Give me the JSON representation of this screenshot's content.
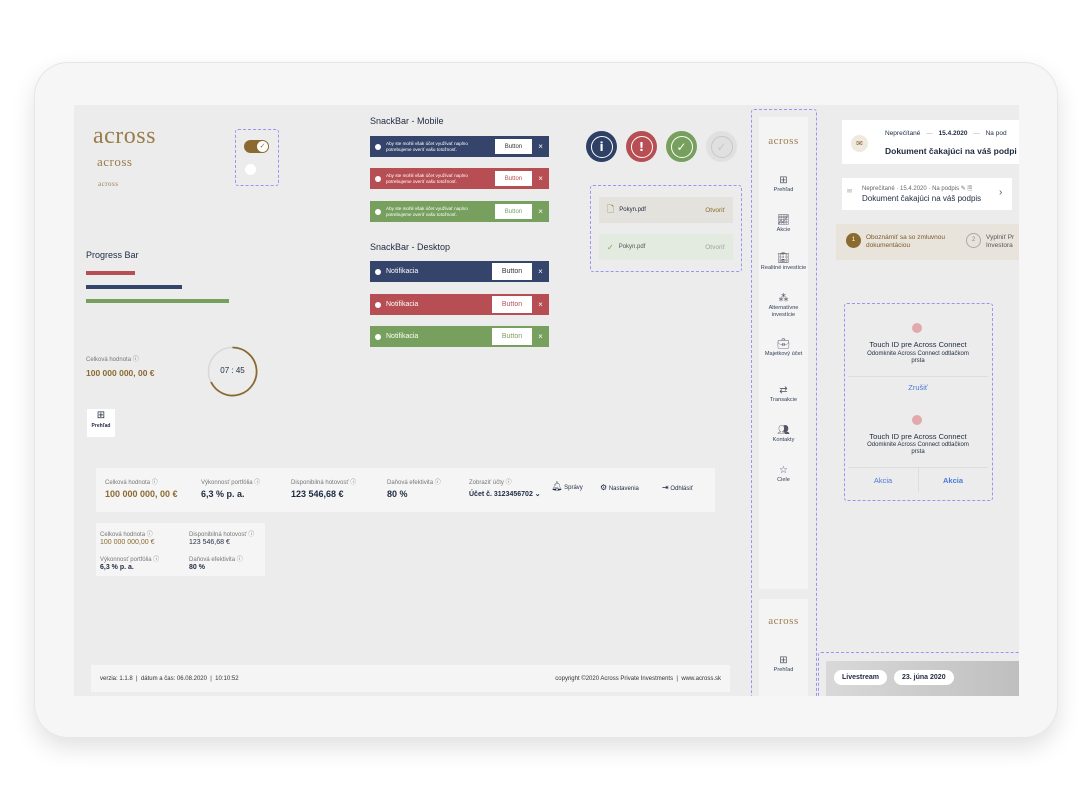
{
  "logo": {
    "text": "across"
  },
  "snackbar_mobile": {
    "title": "SnackBar - Mobile",
    "message": "Aby ste mohli však účet využívať naplno potrebujeme overiť vašu totožnosť.",
    "button": "Button",
    "close": "×"
  },
  "snackbar_desktop": {
    "title": "SnackBar - Desktop",
    "message": "Notifikacia",
    "button": "Button",
    "close": "×"
  },
  "progress": {
    "title": "Progress Bar",
    "bars": [
      0.34,
      0.67,
      1.0
    ],
    "colors": [
      "#b74e53",
      "#34446a",
      "#77a05f"
    ]
  },
  "value_widget": {
    "label": "Celková hodnota",
    "value": "100 000 000, 00 €",
    "timer": "07 : 45"
  },
  "prehlad_tile": {
    "label": "Prehľad"
  },
  "files": {
    "name": "Pokyn.pdf",
    "action": "Otvoriť"
  },
  "status_icons": [
    "info",
    "alert",
    "check",
    "check-disabled"
  ],
  "sidenav": [
    {
      "icon": "grid-icon",
      "label": "Prehľad"
    },
    {
      "icon": "chart-icon",
      "label": "Akcie"
    },
    {
      "icon": "building-icon",
      "label": "Realitné investície"
    },
    {
      "icon": "nodes-icon",
      "label": "Alternatívne investície"
    },
    {
      "icon": "briefcase-icon",
      "label": "Majetkový účet"
    },
    {
      "icon": "transfer-icon",
      "label": "Transakcie"
    },
    {
      "icon": "contacts-icon",
      "label": "Kontakty"
    },
    {
      "icon": "star-icon",
      "label": "Ciele"
    }
  ],
  "sidenav2": {
    "label": "Prehľad"
  },
  "notification": {
    "status": "Neprečítané",
    "date": "15.4.2020",
    "status2": "Na pod",
    "title": "Dokument čakajúci na váš podpis",
    "title_cut": "Dokument čakajúci na váš podpi",
    "small_status": "Neprečítané",
    "small_date": "15.4.2020",
    "small_sign": "Na podpis"
  },
  "steps": [
    {
      "num": "1",
      "text": "Oboznámiť sa so zmluvnou dokumentáciou"
    },
    {
      "num": "2",
      "text": "Vyplniť Pr Investora"
    }
  ],
  "touchid": {
    "title": "Touch ID pre Across Connect",
    "subtitle": "Odomknite Across Connect odtlačkom prsta",
    "cancel": "Zrušiť",
    "action1": "Akcia",
    "action2": "Akcia"
  },
  "summary_bar": {
    "items": [
      {
        "label": "Celková hodnota",
        "value": "100 000 000, 00 €"
      },
      {
        "label": "Výkonnosť portfólia",
        "value": "6,3 % p. a."
      },
      {
        "label": "Disponibilná hotovosť",
        "value": "123 546,68 €"
      },
      {
        "label": "Daňová efektivita",
        "value": "80 %"
      }
    ],
    "accounts_label": "Zobraziť účty",
    "account": "Účet č. 3123456702",
    "messages": "Správy",
    "settings": "Nastavenia",
    "logout": "Odhlásiť"
  },
  "summary_small": {
    "items": [
      {
        "label": "Celková hodnota",
        "value": "100 000 000,00 €"
      },
      {
        "label": "Disponibilná hotovosť",
        "value": "123 546,68 €"
      },
      {
        "label": "Výkonnosť portfólia",
        "value": "6,3 % p. a."
      },
      {
        "label": "Daňová efektivita",
        "value": "80 %"
      }
    ]
  },
  "footer": {
    "left": "verzia: 1.1.8  |  dátum a čas: 06.08.2020  |  10:10:52",
    "right": "copyright ©2020 Across Private Investments  |  www.across.sk"
  },
  "livestream": {
    "tag": "Livestream",
    "date": "23. júna 2020"
  }
}
